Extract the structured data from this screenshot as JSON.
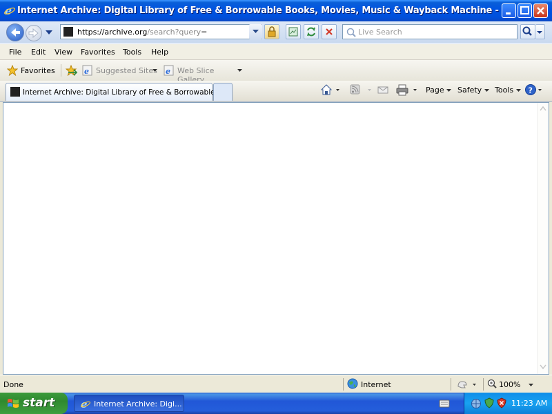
{
  "window": {
    "title": "Internet Archive: Digital Library of Free & Borrowable Books, Movies, Music & Wayback Machine - Windows Int...",
    "title_accent": "#0054e3"
  },
  "navbar": {
    "address_host": "https://archive.org",
    "address_path": "/search?query=",
    "search_placeholder": "Live Search"
  },
  "menu": {
    "items": [
      "File",
      "Edit",
      "View",
      "Favorites",
      "Tools",
      "Help"
    ]
  },
  "favorites_bar": {
    "favorites_label": "Favorites",
    "suggested_sites": "Suggested Sites",
    "web_slice_gallery": "Web Slice Gallery"
  },
  "tabs": {
    "active_title": "Internet Archive: Digital Library of Free & Borrowable ..."
  },
  "command_bar": {
    "page": "Page",
    "safety": "Safety",
    "tools": "Tools"
  },
  "status": {
    "text": "Done",
    "zone": "Internet",
    "zoom": "100%"
  },
  "taskbar": {
    "start": "start",
    "task_title": "Internet Archive: Digi...",
    "clock": "11:23 AM"
  }
}
